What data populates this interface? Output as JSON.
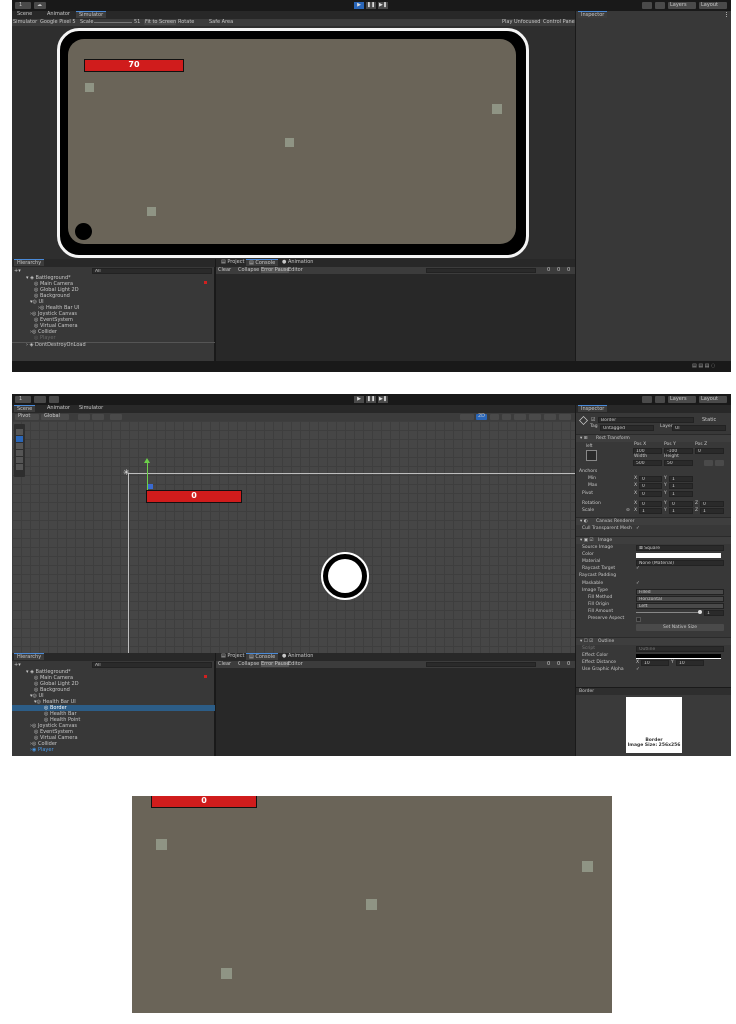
{
  "s1": {
    "toolbar": {
      "account": "1",
      "play": "▶",
      "pause": "❚❚",
      "step": "▶❚",
      "layers": "Layers",
      "layout": "Layout"
    },
    "tabs": [
      "Scene",
      "Animator",
      "Simulator"
    ],
    "simbar": {
      "mode": "Simulator",
      "device": "Google Pixel 5",
      "scale_label": "Scale",
      "scale_value": "51",
      "fit": "Fit to Screen",
      "rotate": "Rotate",
      "safe_area": "Safe Area",
      "play_mode": "Play Unfocused",
      "control_panel": "Control Panel"
    },
    "health_value": "70",
    "inspector_tab": "Inspector",
    "hierarchy_tab": "Hierarchy",
    "search_placeholder": "All",
    "hierarchy": [
      "Battleground*",
      "Main Camera",
      "Global Light 2D",
      "Background",
      "UI",
      "Health Bar UI",
      "Joystick Canvas",
      "EventSystem",
      "Virtual Camera",
      "Collider",
      "Player",
      "DontDestroyOnLoad"
    ],
    "bottom_tabs": [
      "Project",
      "Console",
      "Animation"
    ],
    "console": {
      "clear": "Clear",
      "collapse": "Collapse",
      "error_pause": "Error Pause",
      "editor": "Editor",
      "c1": "0",
      "c2": "0",
      "c3": "0"
    }
  },
  "s2": {
    "toolbar": {
      "account": "1",
      "play": "▶",
      "pause": "❚❚",
      "step": "▶❚",
      "layers": "Layers",
      "layout": "Layout"
    },
    "tabs": [
      "Scene",
      "Animator",
      "Simulator"
    ],
    "scenebar": {
      "pivot": "Pivot",
      "global": "Global",
      "mode2d": "2D"
    },
    "health_value": "0",
    "inspector": {
      "tab": "Inspector",
      "name": "Border",
      "static": "Static",
      "tag_label": "Tag",
      "tag": "Untagged",
      "layer_label": "Layer",
      "layer": "UI",
      "rect_transform": "Rect Transform",
      "anchor_preset": "left",
      "posx_label": "Pos X",
      "posy_label": "Pos Y",
      "posz_label": "Pos Z",
      "posx": "100",
      "posy": "-100",
      "posz": "0",
      "width_label": "Width",
      "height_label": "Height",
      "width": "500",
      "height": "50",
      "anchors": "Anchors",
      "min": "Min",
      "max": "Max",
      "pivot": "Pivot",
      "min_x": "0",
      "min_y": "1",
      "max_x": "0",
      "max_y": "1",
      "pivot_x": "0",
      "pivot_y": "1",
      "rotation": "Rotation",
      "scale": "Scale",
      "rot_x": "0",
      "rot_y": "0",
      "rot_z": "0",
      "scale_lock": "⊝",
      "scale_x": "1",
      "scale_y": "1",
      "scale_z": "1",
      "canvas_renderer": "Canvas Renderer",
      "cull": "Cull Transparent Mesh",
      "image": "Image",
      "source_image_label": "Source Image",
      "source_image": "Square",
      "color_label": "Color",
      "material_label": "Material",
      "material": "None (Material)",
      "raycast_target": "Raycast Target",
      "raycast_padding": "Raycast Padding",
      "maskable": "Maskable",
      "image_type_label": "Image Type",
      "image_type": "Filled",
      "fill_method_label": "Fill Method",
      "fill_method": "Horizontal",
      "fill_origin_label": "Fill Origin",
      "fill_origin": "Left",
      "fill_amount_label": "Fill Amount",
      "fill_amount": "1",
      "preserve_aspect": "Preserve Aspect",
      "set_native": "Set Native Size",
      "outline": "Outline",
      "script_label": "Script",
      "script": "Outline",
      "effect_color_label": "Effect Color",
      "effect_distance_label": "Effect Distance",
      "dist_x": "10",
      "dist_y": "10",
      "use_graphic_alpha": "Use Graphic Alpha",
      "preview_name": "Border",
      "preview_title": "Border",
      "preview_size": "Image Size: 256x256"
    },
    "hierarchy_tab": "Hierarchy",
    "search_placeholder": "All",
    "hierarchy": [
      "Battleground*",
      "Main Camera",
      "Global Light 2D",
      "Background",
      "UI",
      "Health Bar UI",
      "Border",
      "Health Bar",
      "Health Point",
      "Joystick Canvas",
      "EventSystem",
      "Virtual Camera",
      "Collider",
      "Player"
    ],
    "bottom_tabs": [
      "Project",
      "Console",
      "Animation"
    ],
    "console": {
      "clear": "Clear",
      "collapse": "Collapse",
      "error_pause": "Error Pause",
      "editor": "Editor",
      "c1": "0",
      "c2": "0",
      "c3": "0"
    }
  },
  "s3": {
    "health_value": "0"
  },
  "colors": {
    "game_bg": "#6a6458",
    "health_red": "#d01c1c",
    "selection": "#2c5d87",
    "accent": "#4a8ad8"
  }
}
